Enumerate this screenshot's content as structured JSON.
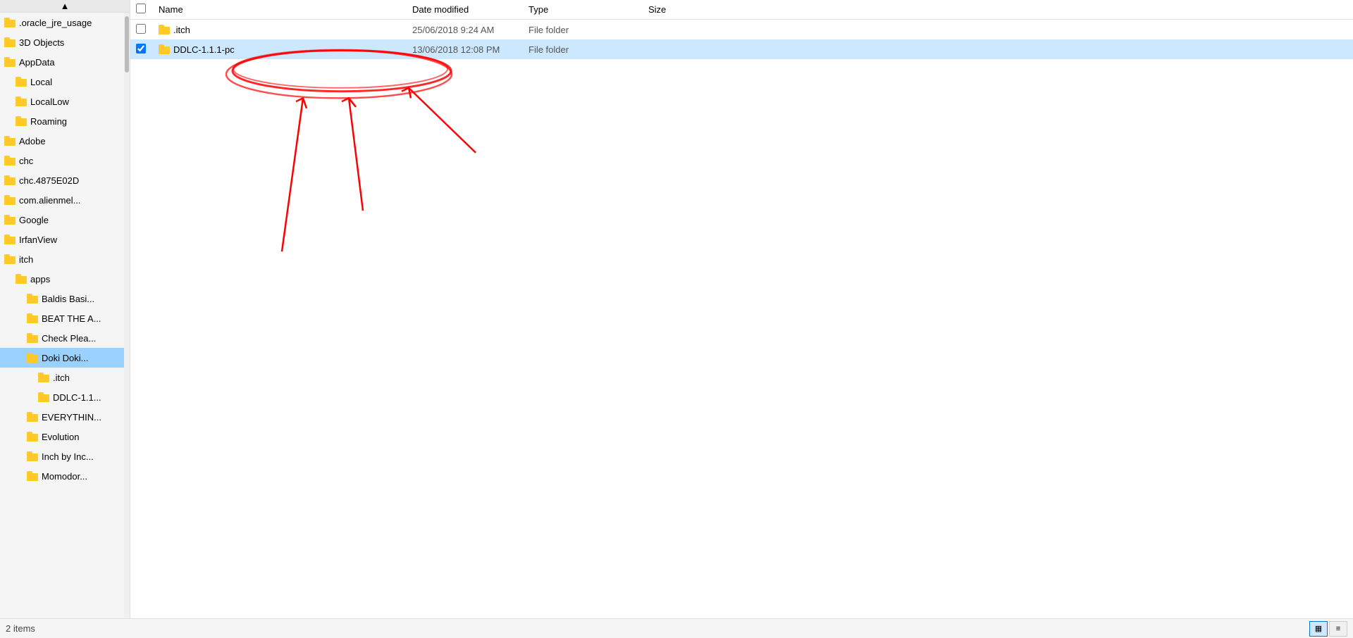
{
  "sidebar": {
    "scroll_up_arrow": "▲",
    "items": [
      {
        "id": "oracle_jre_usage",
        "label": ".oracle_jre_usage",
        "indent": 0,
        "type": "folder"
      },
      {
        "id": "3d_objects",
        "label": "3D Objects",
        "indent": 0,
        "type": "folder"
      },
      {
        "id": "appdata",
        "label": "AppData",
        "indent": 0,
        "type": "folder"
      },
      {
        "id": "local",
        "label": "Local",
        "indent": 1,
        "type": "folder"
      },
      {
        "id": "locallow",
        "label": "LocalLow",
        "indent": 1,
        "type": "folder"
      },
      {
        "id": "roaming",
        "label": "Roaming",
        "indent": 1,
        "type": "folder"
      },
      {
        "id": "adobe",
        "label": "Adobe",
        "indent": 0,
        "type": "folder"
      },
      {
        "id": "chc",
        "label": "chc",
        "indent": 0,
        "type": "folder"
      },
      {
        "id": "chc4875",
        "label": "chc.4875E02D",
        "indent": 0,
        "type": "folder"
      },
      {
        "id": "comalien",
        "label": "com.alienmel...",
        "indent": 0,
        "type": "folder"
      },
      {
        "id": "google",
        "label": "Google",
        "indent": 0,
        "type": "folder"
      },
      {
        "id": "irfanview",
        "label": "IrfanView",
        "indent": 0,
        "type": "folder"
      },
      {
        "id": "itch",
        "label": "itch",
        "indent": 0,
        "type": "folder"
      },
      {
        "id": "apps",
        "label": "apps",
        "indent": 1,
        "type": "folder"
      },
      {
        "id": "baldis_basi",
        "label": "Baldis Basi...",
        "indent": 2,
        "type": "folder"
      },
      {
        "id": "beat_the_a",
        "label": "BEAT THE A...",
        "indent": 2,
        "type": "folder"
      },
      {
        "id": "check_plea",
        "label": "Check Plea...",
        "indent": 2,
        "type": "folder"
      },
      {
        "id": "doki_doki",
        "label": "Doki Doki...",
        "indent": 2,
        "type": "folder",
        "selected": true
      },
      {
        "id": "dot_itch",
        "label": ".itch",
        "indent": 3,
        "type": "folder"
      },
      {
        "id": "ddlc_1_1",
        "label": "DDLC-1.1...",
        "indent": 3,
        "type": "folder"
      },
      {
        "id": "everything",
        "label": "EVERYTHIN...",
        "indent": 2,
        "type": "folder"
      },
      {
        "id": "evolution",
        "label": "Evolution",
        "indent": 2,
        "type": "folder"
      },
      {
        "id": "inch_by_inc",
        "label": "Inch by Inc...",
        "indent": 2,
        "type": "folder"
      },
      {
        "id": "momodor",
        "label": "Momodor...",
        "indent": 2,
        "type": "folder"
      }
    ]
  },
  "content": {
    "columns": {
      "name": "Name",
      "date_modified": "Date modified",
      "type": "Type",
      "size": "Size"
    },
    "files": [
      {
        "id": "dot_itch_folder",
        "name": ".itch",
        "date_modified": "25/06/2018 9:24 AM",
        "type": "File folder",
        "size": "",
        "selected": false
      },
      {
        "id": "ddlc_folder",
        "name": "DDLC-1.1.1-pc",
        "date_modified": "13/06/2018 12:08 PM",
        "type": "File folder",
        "size": "",
        "selected": true
      }
    ]
  },
  "status_bar": {
    "items_count": "2 items",
    "view_list_icon": "≡",
    "view_detail_icon": "▦"
  }
}
